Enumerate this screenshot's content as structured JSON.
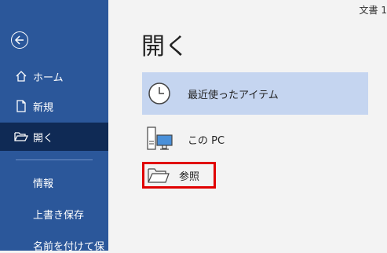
{
  "window": {
    "doc_title": "文書 1"
  },
  "sidebar": {
    "items": [
      {
        "label": "ホーム",
        "icon": "home-icon"
      },
      {
        "label": "新規",
        "icon": "new-document-icon"
      },
      {
        "label": "開く",
        "icon": "open-folder-icon",
        "active": true
      }
    ],
    "sub_items": [
      {
        "label": "情報"
      },
      {
        "label": "上書き保存"
      },
      {
        "label": "名前を付けて保"
      }
    ]
  },
  "main": {
    "title": "開く",
    "options": [
      {
        "label": "最近使ったアイテム",
        "icon": "clock-icon",
        "selected": true
      },
      {
        "label": "この PC",
        "icon": "computer-icon"
      },
      {
        "label": "参照",
        "icon": "folder-icon",
        "highlight_color": "#e00000"
      }
    ]
  },
  "colors": {
    "sidebar": "#2b579a",
    "active": "#0f2a55",
    "selected": "#c5d5f0"
  }
}
